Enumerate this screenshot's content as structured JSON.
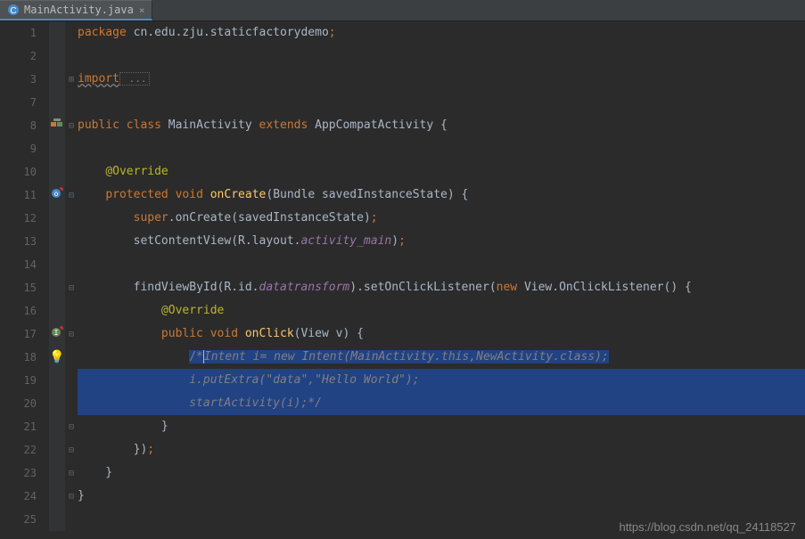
{
  "tab": {
    "filename": "MainActivity.java",
    "close": "×"
  },
  "gutter": {
    "lines": [
      "1",
      "2",
      "3",
      "7",
      "8",
      "9",
      "10",
      "11",
      "12",
      "13",
      "14",
      "15",
      "16",
      "17",
      "18",
      "19",
      "20",
      "21",
      "22",
      "23",
      "24",
      "25"
    ]
  },
  "code": {
    "pkg_kw": "package",
    "pkg_name": " cn.edu.zju.staticfactorydemo",
    "import_kw": "import",
    "import_dots": " ...",
    "public_kw": "public",
    "class_kw": "class",
    "class_name": "MainActivity",
    "extends_kw": "extends",
    "super_class": "AppCompatActivity",
    "override": "@Override",
    "protected_kw": "protected",
    "void_kw": "void",
    "onCreate": "onCreate",
    "bundle": "Bundle",
    "sis": "savedInstanceState",
    "super_kw": "super",
    "onCreate2": "onCreate",
    "scv": "setContentView",
    "rlayout": "R.layout.",
    "activity_main": "activity_main",
    "fvbi": "findViewById",
    "rid": "R.id.",
    "datatransform": "datatransform",
    "socl": ".setOnClickListener",
    "new_kw": "new",
    "viewocl": "View.OnClickListener",
    "onClick": "onClick",
    "view": "View",
    "v": "v",
    "comment1": "/*",
    "comment1b": "Intent i= new Intent(MainActivity.this,NewActivity.class);",
    "comment2": "i.putExtra(\"data\",\"Hello World\");",
    "comment3": "startActivity(i);*/"
  },
  "watermark": "https://blog.csdn.net/qq_24118527"
}
